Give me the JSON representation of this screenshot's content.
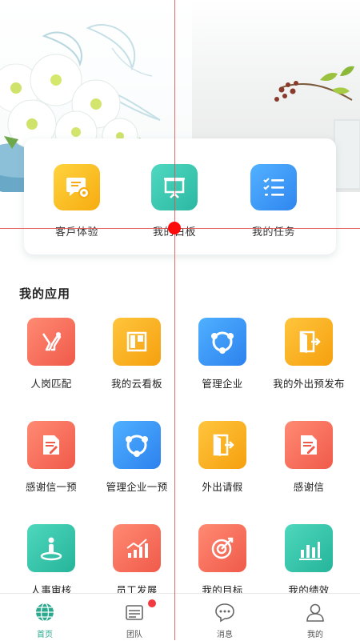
{
  "quick_actions": [
    {
      "label": "客戶体验",
      "icon": "document-gear-icon"
    },
    {
      "label": "我的白板",
      "icon": "whiteboard-icon"
    },
    {
      "label": "我的任务",
      "icon": "task-list-icon"
    }
  ],
  "section_title": "我的应用",
  "apps": [
    {
      "label": "人岗匹配",
      "icon": "person-match-icon",
      "color": "#f26b5b"
    },
    {
      "label": "我的云看板",
      "icon": "kanban-icon",
      "color": "#f5a623"
    },
    {
      "label": "管理企业",
      "icon": "share-network-icon",
      "color": "#3a91f5"
    },
    {
      "label": "我的外出预发布",
      "icon": "exit-door-icon",
      "color": "#f5a623"
    },
    {
      "label": "感谢信一预",
      "icon": "letter-edit-icon",
      "color": "#f26b5b"
    },
    {
      "label": "管理企业一预",
      "icon": "share-network-icon",
      "color": "#3a91f5"
    },
    {
      "label": "外出请假",
      "icon": "exit-door-icon",
      "color": "#f5a623"
    },
    {
      "label": "感谢信",
      "icon": "letter-edit-icon",
      "color": "#f26b5b"
    },
    {
      "label": "人事审核",
      "icon": "location-person-icon",
      "color": "#2cbf9f"
    },
    {
      "label": "员工发展",
      "icon": "growth-chart-icon",
      "color": "#f26b5b"
    },
    {
      "label": "我的目标",
      "icon": "target-icon",
      "color": "#f26b5b"
    },
    {
      "label": "我的绩效",
      "icon": "bar-chart-icon",
      "color": "#2cbf9f"
    }
  ],
  "tabs": [
    {
      "label": "首页",
      "icon": "globe-icon",
      "active": true
    },
    {
      "label": "团队",
      "icon": "team-card-icon",
      "badge": true
    },
    {
      "label": "消息",
      "icon": "chat-bubble-icon"
    },
    {
      "label": "我的",
      "icon": "user-icon"
    }
  ],
  "colors": {
    "accent": "#2aa98f",
    "badge": "#f2393d",
    "crosshair": "#ff0a0a"
  }
}
